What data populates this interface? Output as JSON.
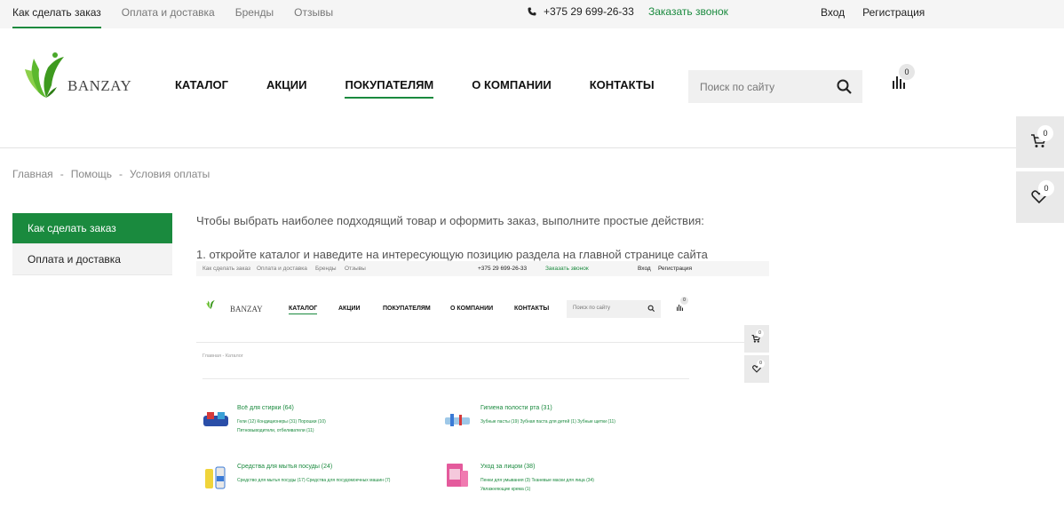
{
  "topbar": {
    "links": [
      "Как сделать заказ",
      "Оплата и доставка",
      "Бренды",
      "Отзывы"
    ],
    "phone": "+375 29 699-26-33",
    "callback": "Заказать звонок",
    "login": "Вход",
    "register": "Регистрация"
  },
  "header": {
    "logo_text": "BANZAY",
    "nav": [
      "КАТАЛОГ",
      "АКЦИИ",
      "ПОКУПАТЕЛЯМ",
      "О КОМПАНИИ",
      "КОНТАКТЫ"
    ],
    "active_nav": "ПОКУПАТЕЛЯМ",
    "search_placeholder": "Поиск по сайту",
    "compare_count": "0"
  },
  "side": {
    "cart_count": "0",
    "favorites_count": "0"
  },
  "breadcrumb": [
    "Главная",
    "-",
    "Помощь",
    "-",
    "Условия оплаты"
  ],
  "leftmenu": {
    "items": [
      "Как сделать заказ",
      "Оплата и доставка"
    ],
    "active": "Как сделать заказ"
  },
  "content": {
    "intro": "Чтобы выбрать наиболее подходящий товар и оформить заказ, выполните простые действия:",
    "step1": "1. откройте каталог и наведите на интересующую позицию раздела на главной странице сайта"
  },
  "screenshot": {
    "top_links": [
      "Как сделать заказ",
      "Оплата и доставка",
      "Бренды",
      "Отзывы"
    ],
    "phone": "+375 29 699-26-33",
    "callback": "Заказать звонок",
    "login": "Вход",
    "register": "Регистрация",
    "logo_text": "BANZAY",
    "nav": [
      "КАТАЛОГ",
      "АКЦИИ",
      "ПОКУПАТЕЛЯМ",
      "О КОМПАНИИ",
      "КОНТАКТЫ"
    ],
    "search_placeholder": "Поиск по сайту",
    "compare_count": "0",
    "cart_count": "0",
    "fav_count": "0",
    "crumb": "Главная  -  Каталог",
    "categories": [
      {
        "title": "Всё для стирки (64)",
        "sub1": "Гели (12)   Кондиционеры (31)   Порошки (10)",
        "sub2": "Пятновыводители, отбеливатели (11)"
      },
      {
        "title": "Гигиена полости рта (31)",
        "sub1": "Зубные пасты (19)   Зубная паста для детей (1)   Зубные щетки (11)",
        "sub2": ""
      },
      {
        "title": "Средства для мытья посуды (24)",
        "sub1": "Средство для мытья посуды (17)   Средства для посудомоечных машин (7)",
        "sub2": ""
      },
      {
        "title": "Уход за лицом (38)",
        "sub1": "Пенки для умывания (3)   Тканевые маски для лица (34)",
        "sub2": "Увлажняющие крема (1)"
      }
    ]
  },
  "colors": {
    "accent": "#1a8a3e",
    "topbar_bg": "#f5f5f5",
    "widget_bg": "#e9e9e9"
  }
}
